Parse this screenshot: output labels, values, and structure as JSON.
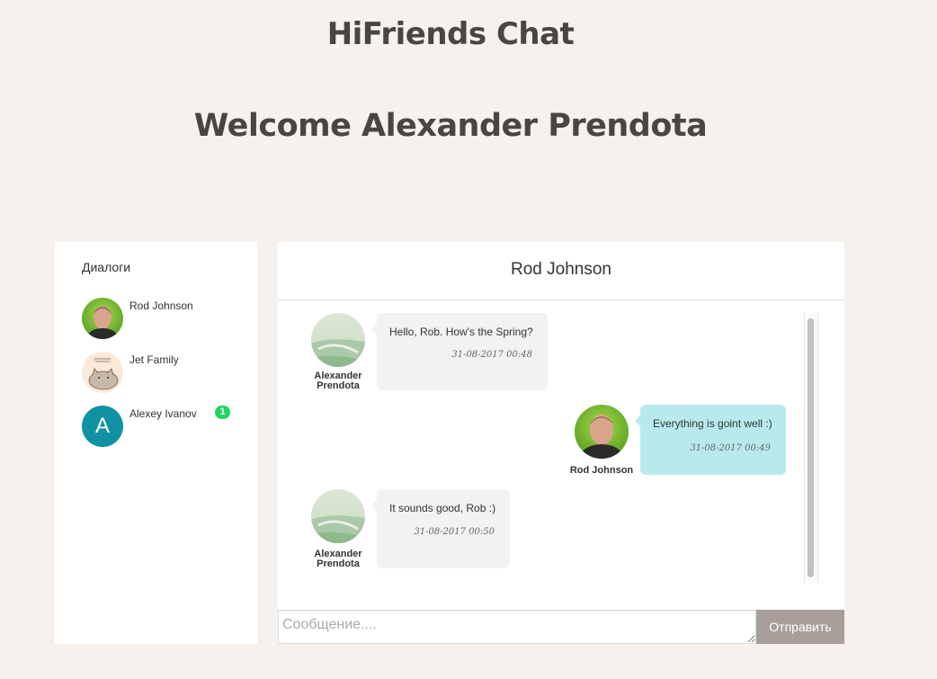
{
  "app": {
    "title": "HiFriends Chat",
    "welcome": "Welcome Alexander Prendota"
  },
  "dialogs": {
    "heading": "Диалоги",
    "items": [
      {
        "name": "Rod Johnson",
        "avatar": "photo-avatar",
        "unread": ""
      },
      {
        "name": "Jet Family",
        "avatar": "cat-avatar",
        "unread": ""
      },
      {
        "name": "Alexey Ivanov",
        "avatar": "A",
        "unread": "1"
      }
    ]
  },
  "chat": {
    "title": "Rod Johnson",
    "messages": [
      {
        "author_line1": "Alexander",
        "author_line2": "Prendota",
        "text": "Hello, Rob. How's the Spring?",
        "time": "31-08-2017 00:48",
        "direction": "in"
      },
      {
        "author_line1": "Rod Johnson",
        "author_line2": "",
        "text": "Everything is goint well :)",
        "time": "31-08-2017 00:49",
        "direction": "out"
      },
      {
        "author_line1": "Alexander",
        "author_line2": "Prendota",
        "text": "It sounds good, Rob :)",
        "time": "31-08-2017 00:50",
        "direction": "in"
      }
    ]
  },
  "composer": {
    "placeholder": "Сообщение....",
    "send_label": "Отправить"
  },
  "colors": {
    "background": "#f6f1ed",
    "outgoing_bubble": "#b8eaed",
    "incoming_bubble": "#f2f2f2",
    "send_button": "#a89f9b",
    "badge": "#1fd65f",
    "letter_avatar": "#1192a3"
  }
}
